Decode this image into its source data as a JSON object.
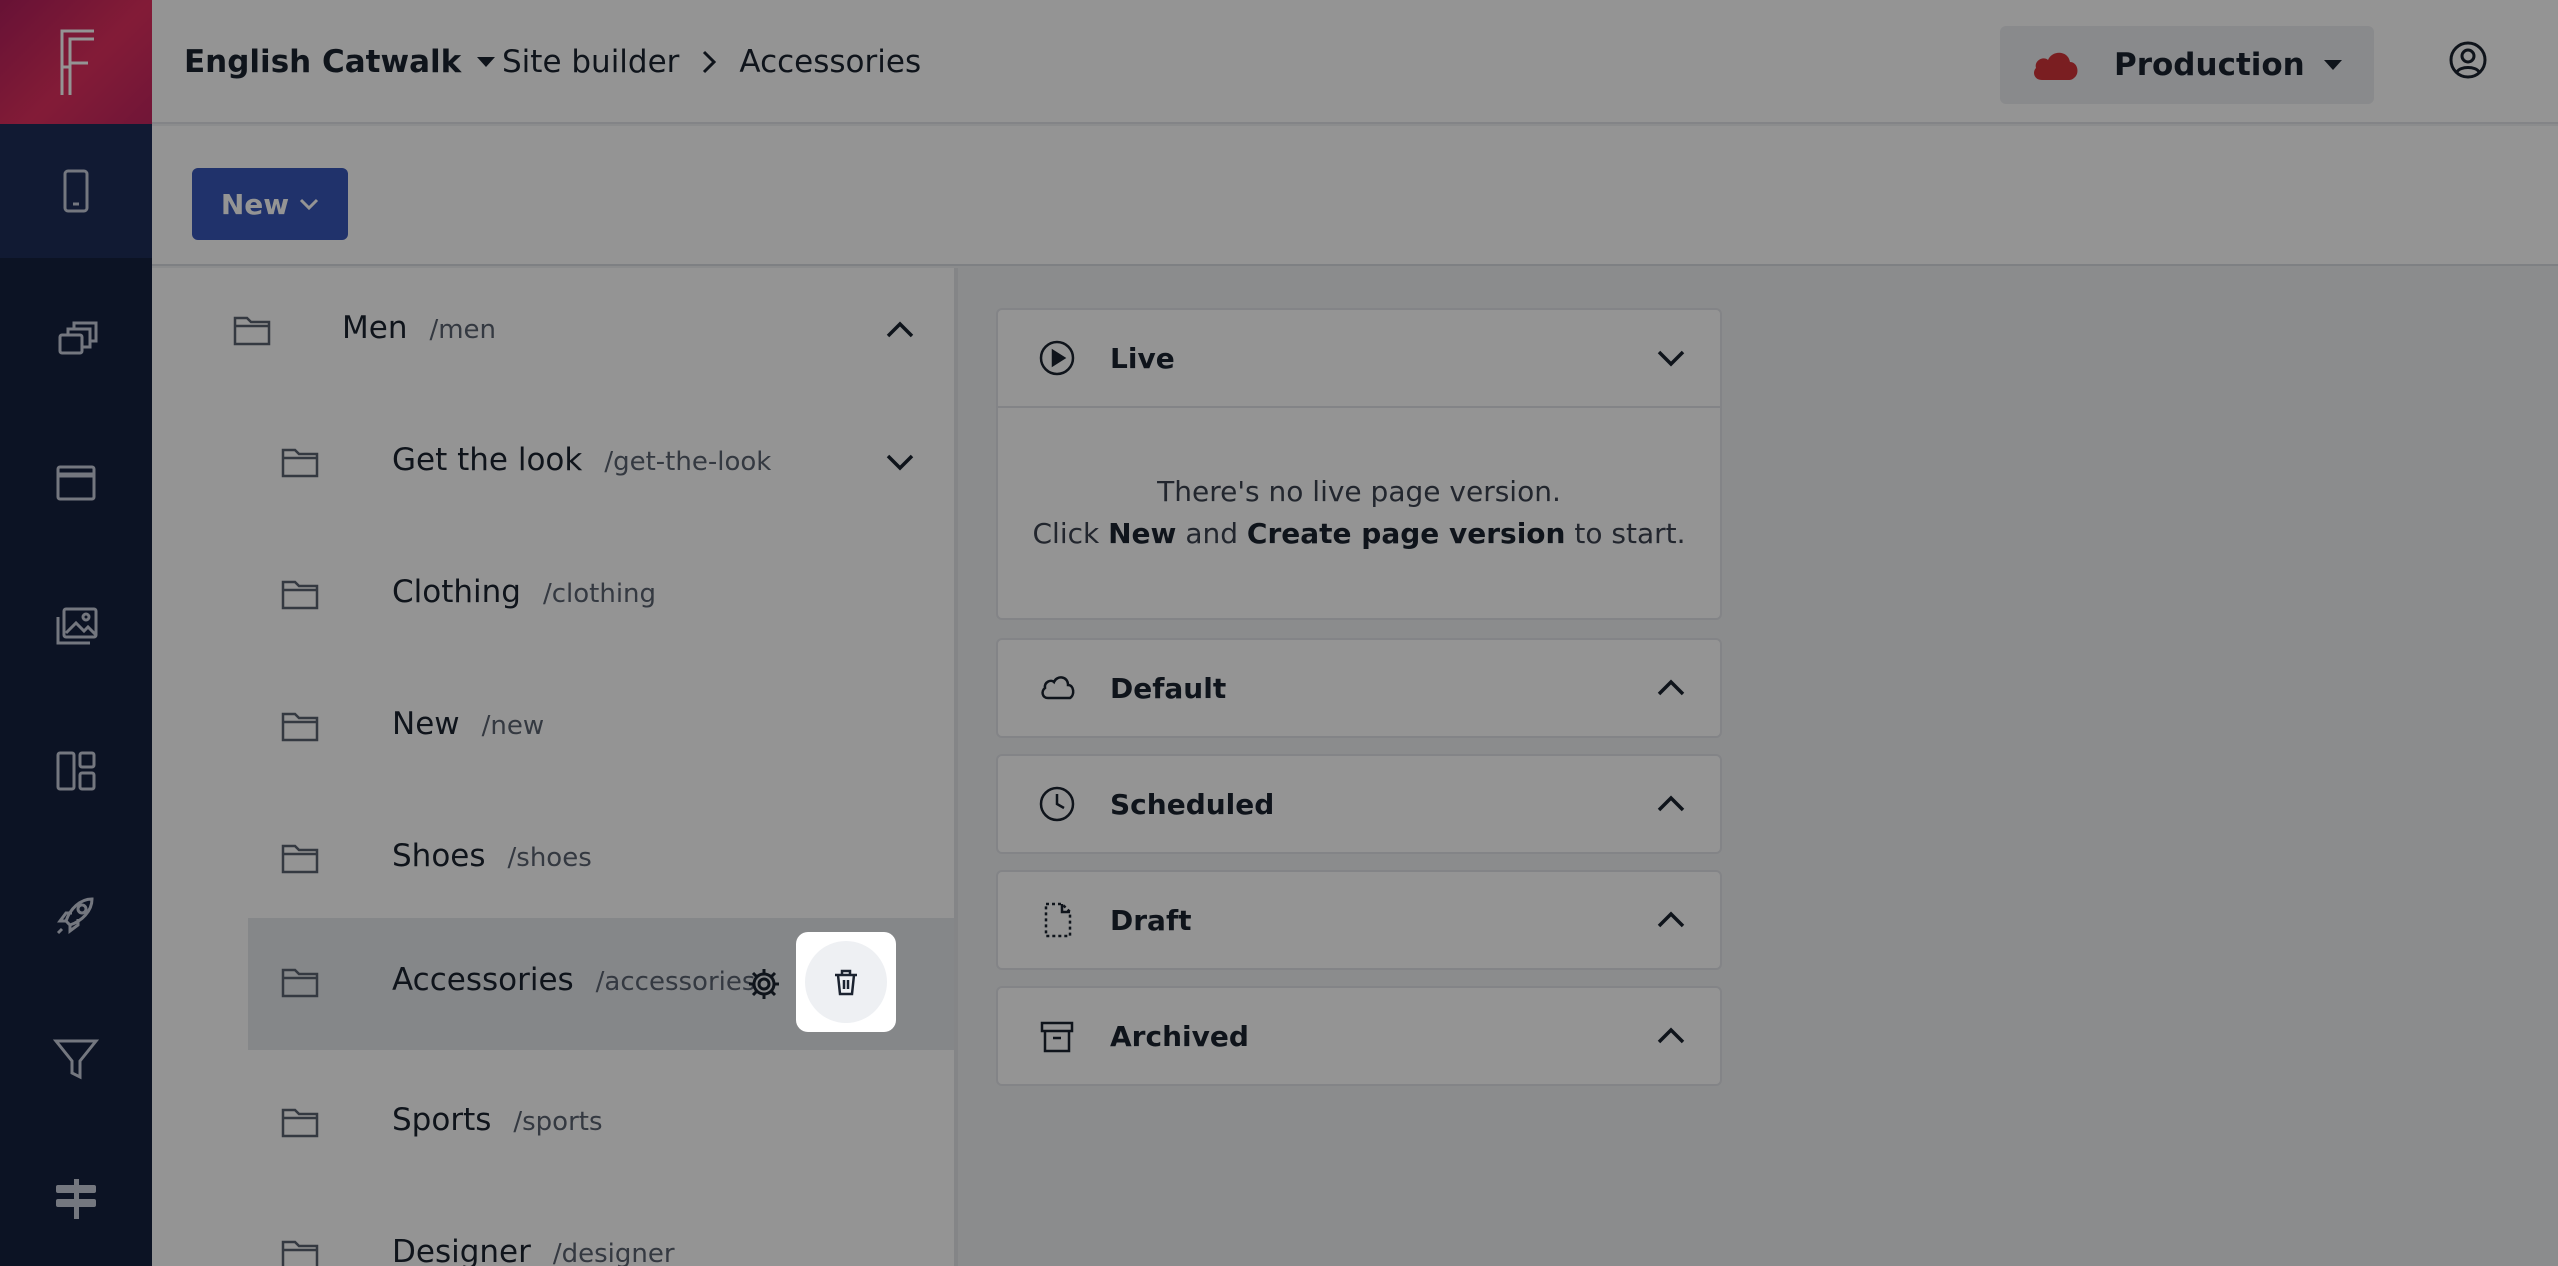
{
  "colors": {
    "sidebar": "#16213f",
    "brand": "#e2305f",
    "accent": "#3856b8",
    "production": "#d2353a"
  },
  "header": {
    "site_name": "English Catwalk",
    "breadcrumb": [
      "Site builder",
      "Accessories"
    ],
    "environment": "Production"
  },
  "sidebar": {
    "items": [
      {
        "icon": "mobile-icon"
      },
      {
        "icon": "pages-icon"
      },
      {
        "icon": "browser-window-icon"
      },
      {
        "icon": "media-library-icon"
      },
      {
        "icon": "layout-icon"
      },
      {
        "icon": "rocket-icon"
      },
      {
        "icon": "filter-icon"
      },
      {
        "icon": "signpost-icon"
      }
    ]
  },
  "toolbar": {
    "new_label": "New"
  },
  "tree": {
    "parent": {
      "name": "Men",
      "path": "/men"
    },
    "children": [
      {
        "name": "Get the look",
        "path": "/get-the-look"
      },
      {
        "name": "Clothing",
        "path": "/clothing"
      },
      {
        "name": "New",
        "path": "/new"
      },
      {
        "name": "Shoes",
        "path": "/shoes"
      },
      {
        "name": "Accessories",
        "path": "/accessories"
      },
      {
        "name": "Sports",
        "path": "/sports"
      },
      {
        "name": "Designer",
        "path": "/designer"
      }
    ]
  },
  "panels": {
    "live": {
      "title": "Live",
      "empty_line1": "There's no live page version.",
      "empty_click": "Click",
      "empty_new": "New",
      "empty_and": "and",
      "empty_create": "Create page version",
      "empty_tail": "to start."
    },
    "default": {
      "title": "Default"
    },
    "scheduled": {
      "title": "Scheduled"
    },
    "draft": {
      "title": "Draft"
    },
    "archived": {
      "title": "Archived"
    }
  }
}
